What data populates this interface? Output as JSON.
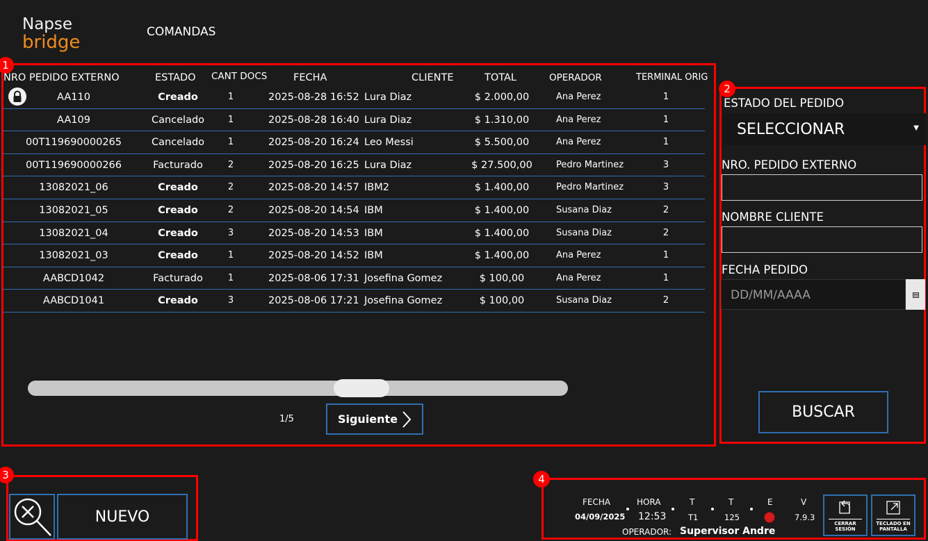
{
  "header": {
    "logo_line1": "Napse",
    "logo_line2": "bridge",
    "title": "COMANDAS"
  },
  "annotations": [
    "1",
    "2",
    "3",
    "4"
  ],
  "table": {
    "columns": [
      "NRO PEDIDO EXTERNO",
      "ESTADO",
      "CANT DOCS",
      "FECHA",
      "CLIENTE",
      "TOTAL",
      "OPERADOR",
      "TERMINAL ORIG"
    ],
    "rows": [
      {
        "nro": "AA110",
        "estado": "Creado",
        "cant": "1",
        "fecha": "2025-08-28 16:52",
        "cliente": "Lura Diaz",
        "total": "$ 2.000,00",
        "operador": "Ana Perez",
        "terminal": "1"
      },
      {
        "nro": "AA109",
        "estado": "Cancelado",
        "cant": "1",
        "fecha": "2025-08-28 16:40",
        "cliente": "Lura Diaz",
        "total": "$ 1.310,00",
        "operador": "Ana Perez",
        "terminal": "1"
      },
      {
        "nro": "00T119690000265",
        "estado": "Cancelado",
        "cant": "1",
        "fecha": "2025-08-20 16:24",
        "cliente": "Leo Messi",
        "total": "$ 5.500,00",
        "operador": "Ana Perez",
        "terminal": "1"
      },
      {
        "nro": "00T119690000266",
        "estado": "Facturado",
        "cant": "2",
        "fecha": "2025-08-20 16:25",
        "cliente": "Lura Diaz",
        "total": "$ 27.500,00",
        "operador": "Pedro Martinez",
        "terminal": "3"
      },
      {
        "nro": "13082021_06",
        "estado": "Creado",
        "cant": "2",
        "fecha": "2025-08-20 14:57",
        "cliente": "IBM2",
        "total": "$ 1.400,00",
        "operador": "Pedro Martinez",
        "terminal": "3"
      },
      {
        "nro": "13082021_05",
        "estado": "Creado",
        "cant": "2",
        "fecha": "2025-08-20 14:54",
        "cliente": "IBM",
        "total": "$ 1.400,00",
        "operador": "Susana Diaz",
        "terminal": "2"
      },
      {
        "nro": "13082021_04",
        "estado": "Creado",
        "cant": "3",
        "fecha": "2025-08-20 14:53",
        "cliente": "IBM",
        "total": "$ 1.400,00",
        "operador": "Susana Diaz",
        "terminal": "2"
      },
      {
        "nro": "13082021_03",
        "estado": "Creado",
        "cant": "1",
        "fecha": "2025-08-20 14:52",
        "cliente": "IBM",
        "total": "$ 1.400,00",
        "operador": "Ana Perez",
        "terminal": "1"
      },
      {
        "nro": "AABCD1042",
        "estado": "Facturado",
        "cant": "1",
        "fecha": "2025-08-06 17:31",
        "cliente": "Josefina Gomez",
        "total": "$ 100,00",
        "operador": "Ana Perez",
        "terminal": "1"
      },
      {
        "nro": "AABCD1041",
        "estado": "Creado",
        "cant": "3",
        "fecha": "2025-08-06 17:21",
        "cliente": "Josefina Gomez",
        "total": "$ 100,00",
        "operador": "Susana Diaz",
        "terminal": "2"
      }
    ]
  },
  "pagination": {
    "indicator": "1/5",
    "next_label": "Siguiente"
  },
  "filters": {
    "estado_label": "ESTADO DEL PEDIDO",
    "estado_value": "SELECCIONAR",
    "nro_label": "NRO. PEDIDO EXTERNO",
    "nro_value": "",
    "cliente_label": "NOMBRE CLIENTE",
    "cliente_value": "",
    "fecha_label": "FECHA PEDIDO",
    "fecha_placeholder": "DD/MM/AAAA",
    "search_label": "BUSCAR"
  },
  "actions": {
    "nuevo_label": "NUEVO"
  },
  "status": {
    "fecha_label": "FECHA",
    "fecha_value": "04/09/2025",
    "hora_label": "HORA",
    "hora_value": "12:53",
    "t1_label": "T",
    "t1_value": "T1",
    "t2_label": "T",
    "t2_value": "125",
    "e_label": "E",
    "v_label": "V",
    "v_value": "7.9.3",
    "operador_label": "OPERADOR:",
    "operador_value": "Supervisor Andre",
    "cerrar_line1": "CERRAR",
    "cerrar_line2": "SESIÓN",
    "teclado_line1": "TECLADO EN",
    "teclado_line2": "PANTALLA",
    "e_status_color": "#d51c1c"
  },
  "colors": {
    "background": "#1b1b1b",
    "accent_blue": "#2f6fb0",
    "annotation_red": "#ff0000",
    "logo_orange": "#f28b1d"
  }
}
